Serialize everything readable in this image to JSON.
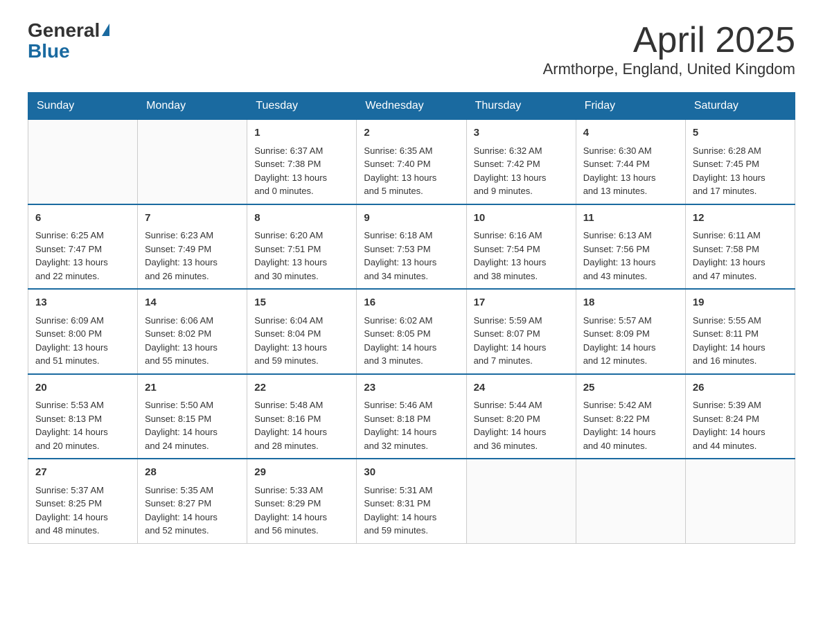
{
  "logo": {
    "top": "General",
    "bottom": "Blue"
  },
  "title": "April 2025",
  "subtitle": "Armthorpe, England, United Kingdom",
  "days_of_week": [
    "Sunday",
    "Monday",
    "Tuesday",
    "Wednesday",
    "Thursday",
    "Friday",
    "Saturday"
  ],
  "weeks": [
    [
      {
        "num": "",
        "info": ""
      },
      {
        "num": "",
        "info": ""
      },
      {
        "num": "1",
        "info": "Sunrise: 6:37 AM\nSunset: 7:38 PM\nDaylight: 13 hours\nand 0 minutes."
      },
      {
        "num": "2",
        "info": "Sunrise: 6:35 AM\nSunset: 7:40 PM\nDaylight: 13 hours\nand 5 minutes."
      },
      {
        "num": "3",
        "info": "Sunrise: 6:32 AM\nSunset: 7:42 PM\nDaylight: 13 hours\nand 9 minutes."
      },
      {
        "num": "4",
        "info": "Sunrise: 6:30 AM\nSunset: 7:44 PM\nDaylight: 13 hours\nand 13 minutes."
      },
      {
        "num": "5",
        "info": "Sunrise: 6:28 AM\nSunset: 7:45 PM\nDaylight: 13 hours\nand 17 minutes."
      }
    ],
    [
      {
        "num": "6",
        "info": "Sunrise: 6:25 AM\nSunset: 7:47 PM\nDaylight: 13 hours\nand 22 minutes."
      },
      {
        "num": "7",
        "info": "Sunrise: 6:23 AM\nSunset: 7:49 PM\nDaylight: 13 hours\nand 26 minutes."
      },
      {
        "num": "8",
        "info": "Sunrise: 6:20 AM\nSunset: 7:51 PM\nDaylight: 13 hours\nand 30 minutes."
      },
      {
        "num": "9",
        "info": "Sunrise: 6:18 AM\nSunset: 7:53 PM\nDaylight: 13 hours\nand 34 minutes."
      },
      {
        "num": "10",
        "info": "Sunrise: 6:16 AM\nSunset: 7:54 PM\nDaylight: 13 hours\nand 38 minutes."
      },
      {
        "num": "11",
        "info": "Sunrise: 6:13 AM\nSunset: 7:56 PM\nDaylight: 13 hours\nand 43 minutes."
      },
      {
        "num": "12",
        "info": "Sunrise: 6:11 AM\nSunset: 7:58 PM\nDaylight: 13 hours\nand 47 minutes."
      }
    ],
    [
      {
        "num": "13",
        "info": "Sunrise: 6:09 AM\nSunset: 8:00 PM\nDaylight: 13 hours\nand 51 minutes."
      },
      {
        "num": "14",
        "info": "Sunrise: 6:06 AM\nSunset: 8:02 PM\nDaylight: 13 hours\nand 55 minutes."
      },
      {
        "num": "15",
        "info": "Sunrise: 6:04 AM\nSunset: 8:04 PM\nDaylight: 13 hours\nand 59 minutes."
      },
      {
        "num": "16",
        "info": "Sunrise: 6:02 AM\nSunset: 8:05 PM\nDaylight: 14 hours\nand 3 minutes."
      },
      {
        "num": "17",
        "info": "Sunrise: 5:59 AM\nSunset: 8:07 PM\nDaylight: 14 hours\nand 7 minutes."
      },
      {
        "num": "18",
        "info": "Sunrise: 5:57 AM\nSunset: 8:09 PM\nDaylight: 14 hours\nand 12 minutes."
      },
      {
        "num": "19",
        "info": "Sunrise: 5:55 AM\nSunset: 8:11 PM\nDaylight: 14 hours\nand 16 minutes."
      }
    ],
    [
      {
        "num": "20",
        "info": "Sunrise: 5:53 AM\nSunset: 8:13 PM\nDaylight: 14 hours\nand 20 minutes."
      },
      {
        "num": "21",
        "info": "Sunrise: 5:50 AM\nSunset: 8:15 PM\nDaylight: 14 hours\nand 24 minutes."
      },
      {
        "num": "22",
        "info": "Sunrise: 5:48 AM\nSunset: 8:16 PM\nDaylight: 14 hours\nand 28 minutes."
      },
      {
        "num": "23",
        "info": "Sunrise: 5:46 AM\nSunset: 8:18 PM\nDaylight: 14 hours\nand 32 minutes."
      },
      {
        "num": "24",
        "info": "Sunrise: 5:44 AM\nSunset: 8:20 PM\nDaylight: 14 hours\nand 36 minutes."
      },
      {
        "num": "25",
        "info": "Sunrise: 5:42 AM\nSunset: 8:22 PM\nDaylight: 14 hours\nand 40 minutes."
      },
      {
        "num": "26",
        "info": "Sunrise: 5:39 AM\nSunset: 8:24 PM\nDaylight: 14 hours\nand 44 minutes."
      }
    ],
    [
      {
        "num": "27",
        "info": "Sunrise: 5:37 AM\nSunset: 8:25 PM\nDaylight: 14 hours\nand 48 minutes."
      },
      {
        "num": "28",
        "info": "Sunrise: 5:35 AM\nSunset: 8:27 PM\nDaylight: 14 hours\nand 52 minutes."
      },
      {
        "num": "29",
        "info": "Sunrise: 5:33 AM\nSunset: 8:29 PM\nDaylight: 14 hours\nand 56 minutes."
      },
      {
        "num": "30",
        "info": "Sunrise: 5:31 AM\nSunset: 8:31 PM\nDaylight: 14 hours\nand 59 minutes."
      },
      {
        "num": "",
        "info": ""
      },
      {
        "num": "",
        "info": ""
      },
      {
        "num": "",
        "info": ""
      }
    ]
  ]
}
